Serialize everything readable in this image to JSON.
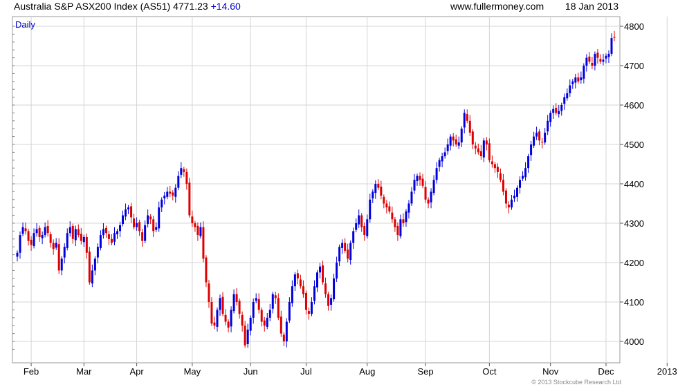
{
  "header": {
    "title": "Australia S&P ASX200 Index (AS51) 4771.23",
    "change": "+14.60",
    "website": "www.fullermoney.com",
    "date": "18 Jan 2013"
  },
  "copyright": "© 2013 Stockcube Research Ltd",
  "colors": {
    "up": "#0000dd",
    "down": "#dd0000",
    "grid": "#d4d4d4",
    "label_accent": "#0000cc"
  },
  "chart_data": {
    "type": "candlestick",
    "period_label": "Daily",
    "y_ticks": [
      4000,
      4100,
      4200,
      4300,
      4400,
      4500,
      4600,
      4700,
      4800
    ],
    "ylim": [
      3965,
      4820
    ],
    "y_axis_side": "right",
    "grid": true,
    "x_tick_labels": [
      "Feb",
      "Mar",
      "Apr",
      "May",
      "Jun",
      "Jul",
      "Aug",
      "Sep",
      "Oct",
      "Nov",
      "Dec",
      "2013"
    ],
    "x_tick_index": [
      5,
      24,
      43,
      63,
      84,
      104,
      126,
      147,
      170,
      192,
      212,
      234
    ],
    "closes": [
      4225,
      4270,
      4290,
      4280,
      4255,
      4245,
      4275,
      4285,
      4265,
      4270,
      4290,
      4275,
      4250,
      4235,
      4250,
      4180,
      4210,
      4240,
      4275,
      4290,
      4260,
      4285,
      4270,
      4255,
      4265,
      4225,
      4150,
      4180,
      4210,
      4240,
      4270,
      4285,
      4275,
      4260,
      4250,
      4275,
      4280,
      4295,
      4320,
      4335,
      4340,
      4315,
      4290,
      4300,
      4280,
      4255,
      4295,
      4320,
      4310,
      4280,
      4290,
      4340,
      4360,
      4370,
      4380,
      4375,
      4370,
      4390,
      4420,
      4440,
      4430,
      4400,
      4320,
      4300,
      4290,
      4270,
      4290,
      4210,
      4150,
      4100,
      4045,
      4040,
      4080,
      4110,
      4070,
      4050,
      4035,
      4080,
      4120,
      4100,
      4070,
      4040,
      3990,
      4030,
      4060,
      4100,
      4110,
      4080,
      4050,
      4040,
      4060,
      4080,
      4120,
      4110,
      4060,
      4020,
      4000,
      4050,
      4100,
      4140,
      4170,
      4160,
      4140,
      4120,
      4080,
      4070,
      4100,
      4140,
      4175,
      4190,
      4150,
      4120,
      4090,
      4110,
      4160,
      4200,
      4240,
      4250,
      4230,
      4210,
      4250,
      4280,
      4300,
      4320,
      4290,
      4270,
      4310,
      4360,
      4380,
      4400,
      4390,
      4370,
      4350,
      4340,
      4330,
      4310,
      4290,
      4270,
      4310,
      4300,
      4330,
      4350,
      4380,
      4410,
      4420,
      4410,
      4395,
      4360,
      4350,
      4380,
      4410,
      4440,
      4460,
      4470,
      4480,
      4500,
      4520,
      4510,
      4500,
      4505,
      4540,
      4580,
      4560,
      4530,
      4500,
      4490,
      4480,
      4470,
      4510,
      4500,
      4460,
      4450,
      4440,
      4430,
      4410,
      4380,
      4350,
      4340,
      4360,
      4370,
      4390,
      4410,
      4420,
      4440,
      4470,
      4500,
      4520,
      4530,
      4510,
      4505,
      4530,
      4560,
      4580,
      4590,
      4580,
      4585,
      4600,
      4620,
      4630,
      4650,
      4660,
      4670,
      4660,
      4670,
      4700,
      4720,
      4710,
      4700,
      4730,
      4720,
      4710,
      4715,
      4725,
      4730,
      4770,
      4771
    ]
  }
}
